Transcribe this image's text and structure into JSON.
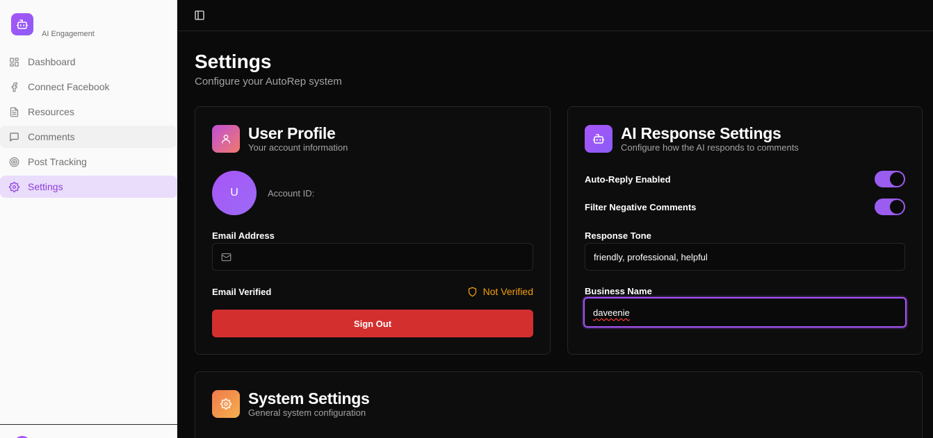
{
  "sidebar": {
    "brand_subtitle": "AI Engagement",
    "items": [
      {
        "label": "Dashboard",
        "icon": "dashboard-grid-icon"
      },
      {
        "label": "Connect Facebook",
        "icon": "facebook-icon"
      },
      {
        "label": "Resources",
        "icon": "document-icon"
      },
      {
        "label": "Comments",
        "icon": "message-square-icon"
      },
      {
        "label": "Post Tracking",
        "icon": "target-icon"
      },
      {
        "label": "Settings",
        "icon": "gear-icon"
      }
    ],
    "active_item": "Settings"
  },
  "page": {
    "title": "Settings",
    "subtitle": "Configure your AutoRep system"
  },
  "user_profile": {
    "title": "User Profile",
    "subtitle": "Your account information",
    "avatar_initial": "U",
    "account_id_label": "Account ID:",
    "email_label": "Email Address",
    "email_value": "",
    "email_verified_label": "Email Verified",
    "verification_status": "Not Verified",
    "sign_out_label": "Sign Out"
  },
  "ai_settings": {
    "title": "AI Response Settings",
    "subtitle": "Configure how the AI responds to comments",
    "auto_reply_label": "Auto-Reply Enabled",
    "auto_reply_on": true,
    "filter_negative_label": "Filter Negative Comments",
    "filter_negative_on": true,
    "tone_label": "Response Tone",
    "tone_value": "friendly, professional, helpful",
    "business_label": "Business Name",
    "business_value": "daveenie"
  },
  "system_settings": {
    "title": "System Settings",
    "subtitle": "General system configuration"
  },
  "colors": {
    "accent": "#a855f7",
    "danger": "#d42f2f",
    "warning": "#f59e0b",
    "background": "#0a0a0b"
  }
}
